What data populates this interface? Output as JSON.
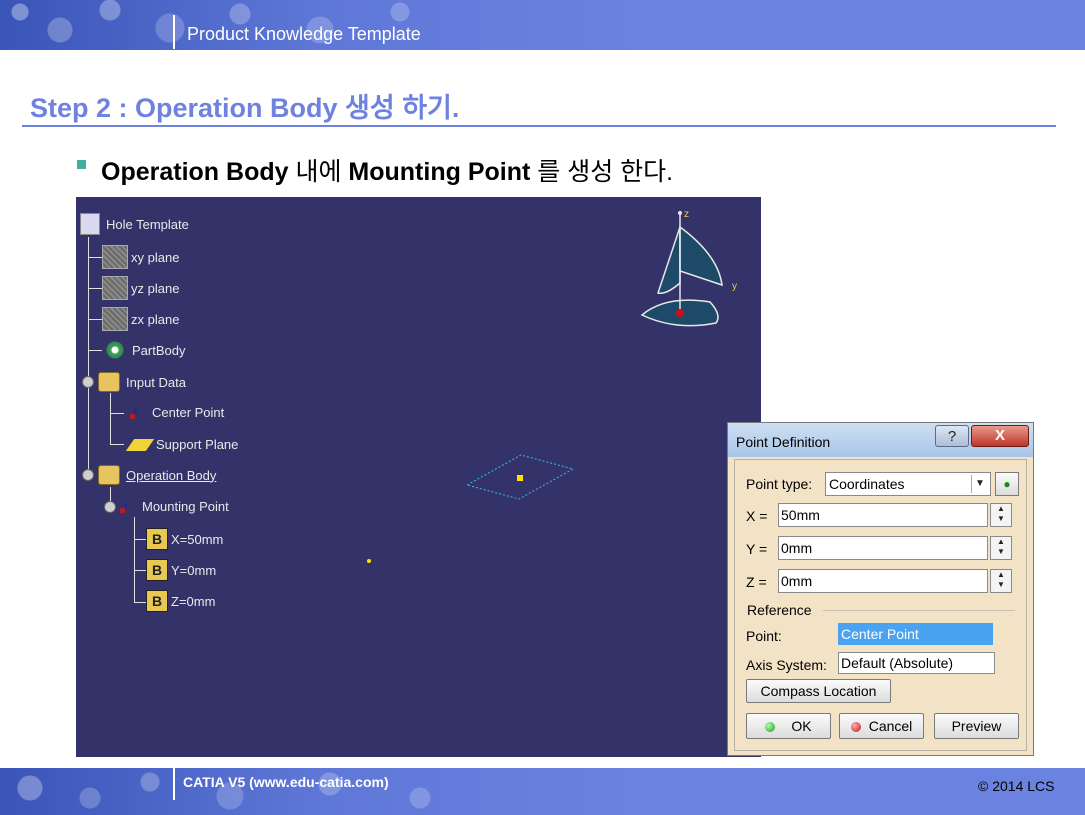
{
  "header": {
    "title": "Product Knowledge Template"
  },
  "slide": {
    "step_title": "Step 2 : Operation Body 생성 하기.",
    "bullet_bold1": "Operation Body",
    "bullet_mid": " 내에 ",
    "bullet_bold2": "Mounting Point",
    "bullet_end": " 를 생성 한다."
  },
  "tree": {
    "root": "Hole Template",
    "xy_plane": "xy plane",
    "yz_plane": "yz plane",
    "zx_plane": "zx plane",
    "part_body": "PartBody",
    "input_data": "Input Data",
    "center_point": "Center Point",
    "support_plane": "Support Plane",
    "operation_body": "Operation Body",
    "mounting_point": "Mounting Point",
    "x_param": "X=50mm",
    "y_param": "Y=0mm",
    "z_param": "Z=0mm"
  },
  "compass": {
    "z_label": "z",
    "y_label": "y"
  },
  "dialog": {
    "title": "Point Definition",
    "help_label": "?",
    "close_label": "X",
    "point_type_label": "Point type:",
    "point_type_value": "Coordinates",
    "x_label": "X =",
    "x_value": "50mm",
    "y_label": "Y =",
    "y_value": "0mm",
    "z_label": "Z =",
    "z_value": "0mm",
    "reference_label": "Reference",
    "point_label": "Point:",
    "point_value": "Center Point",
    "axis_label": "Axis System:",
    "axis_value": "Default (Absolute)",
    "compass_btn": "Compass Location",
    "ok_btn": "OK",
    "cancel_btn": "Cancel",
    "preview_btn": "Preview"
  },
  "footer": {
    "left": "CATIA V5 (www.edu-catia.com)",
    "right": "© 2014 LCS"
  },
  "colors": {
    "accent": "#6f82e0",
    "viewport_bg": "#33336a",
    "dialog_bg": "#f3e3c6",
    "highlight": "#4aa3f0"
  }
}
